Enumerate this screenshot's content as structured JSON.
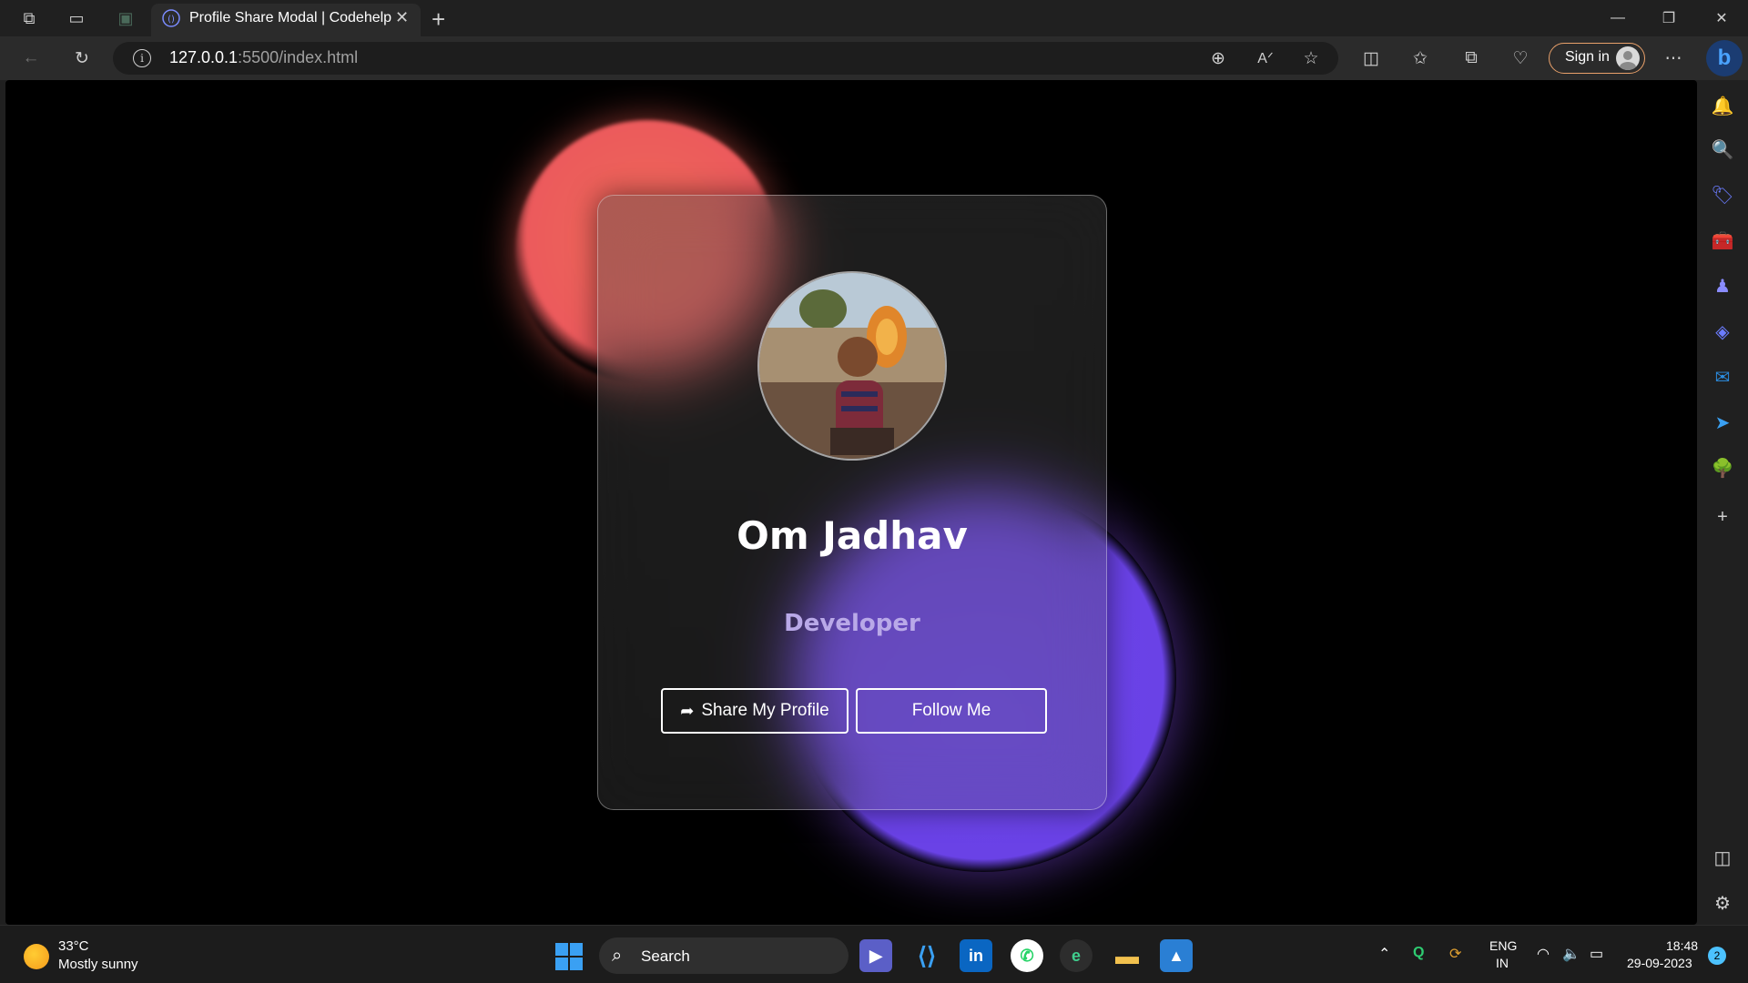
{
  "browser": {
    "tab_title": "Profile Share Modal | Codehelp",
    "url_host": "127.0.0.1",
    "url_path": ":5500/index.html",
    "signin_label": "Sign in"
  },
  "page": {
    "profile_name": "Om Jadhav",
    "profile_role": "Developer",
    "share_button_label": "Share My Profile",
    "follow_button_label": "Follow Me",
    "colors": {
      "blob_red": "#ec5a5c",
      "blob_purple": "#6a42e6",
      "role_text": "#b9a9e8"
    }
  },
  "taskbar": {
    "weather_temp": "33°C",
    "weather_desc": "Mostly sunny",
    "search_label": "Search",
    "lang_line1": "ENG",
    "lang_line2": "IN",
    "time": "18:48",
    "date": "29-09-2023",
    "notification_count": "2"
  }
}
